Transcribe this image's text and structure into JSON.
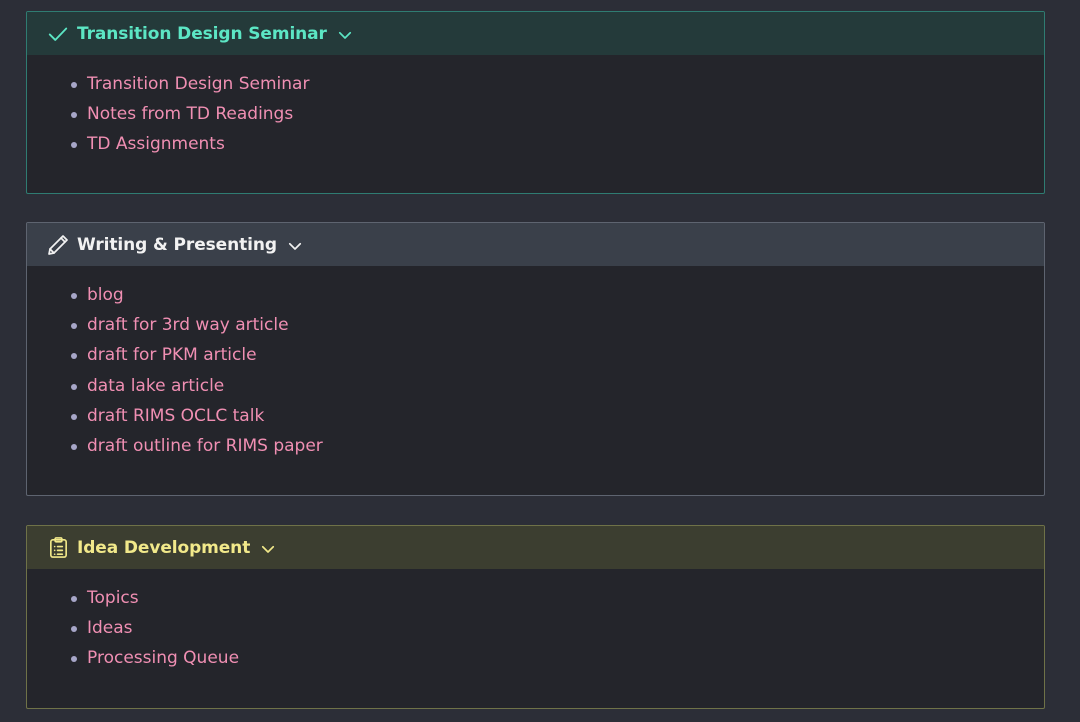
{
  "callouts": [
    {
      "title": "Transition Design Seminar",
      "icon": "check-icon",
      "accent": "#5ce6c4",
      "items": [
        "Transition Design Seminar",
        "Notes from TD Readings",
        "TD Assignments"
      ]
    },
    {
      "title": "Writing & Presenting",
      "icon": "pencil-icon",
      "accent": "#f2f2f2",
      "items": [
        "blog",
        "draft for 3rd way article",
        "draft for PKM article",
        "data lake article",
        "draft RIMS OCLC talk",
        "draft outline for RIMS paper"
      ]
    },
    {
      "title": "Idea Development",
      "icon": "clipboard-list-icon",
      "accent": "#f2e98a",
      "items": [
        "Topics",
        "Ideas",
        "Processing Queue"
      ]
    }
  ],
  "colors": {
    "background": "#2c2e37",
    "link": "#f08fb3",
    "bullet": "#a7a6c8"
  }
}
